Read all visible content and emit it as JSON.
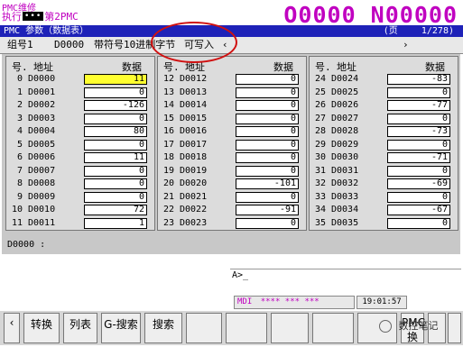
{
  "header": {
    "caption": "PMC维修",
    "mode_label": "执行",
    "mode_dots": "•••",
    "path_label": "第2PMC",
    "program_readout": "O0000 N00000"
  },
  "titlebar": {
    "title": "PMC 参数（数据表）",
    "page_label": "(页",
    "page_value": "1/278)"
  },
  "infobar": {
    "group_label": "组号1",
    "group_addr": "D0000",
    "desc": "带符号10进制字节",
    "mode": "可写入",
    "left_arrow": "‹",
    "right_arrow": "›"
  },
  "table": {
    "col_no": "号.",
    "col_addr": "地址",
    "col_data": "数据",
    "panels": [
      {
        "rows": [
          {
            "no": "0",
            "addr": "D0000",
            "val": "11"
          },
          {
            "no": "1",
            "addr": "D0001",
            "val": "0"
          },
          {
            "no": "2",
            "addr": "D0002",
            "val": "-126"
          },
          {
            "no": "3",
            "addr": "D0003",
            "val": "0"
          },
          {
            "no": "4",
            "addr": "D0004",
            "val": "80"
          },
          {
            "no": "5",
            "addr": "D0005",
            "val": "0"
          },
          {
            "no": "6",
            "addr": "D0006",
            "val": "11"
          },
          {
            "no": "7",
            "addr": "D0007",
            "val": "0"
          },
          {
            "no": "8",
            "addr": "D0008",
            "val": "0"
          },
          {
            "no": "9",
            "addr": "D0009",
            "val": "0"
          },
          {
            "no": "10",
            "addr": "D0010",
            "val": "72"
          },
          {
            "no": "11",
            "addr": "D0011",
            "val": "1"
          }
        ]
      },
      {
        "rows": [
          {
            "no": "12",
            "addr": "D0012",
            "val": "0"
          },
          {
            "no": "13",
            "addr": "D0013",
            "val": "0"
          },
          {
            "no": "14",
            "addr": "D0014",
            "val": "0"
          },
          {
            "no": "15",
            "addr": "D0015",
            "val": "0"
          },
          {
            "no": "16",
            "addr": "D0016",
            "val": "0"
          },
          {
            "no": "17",
            "addr": "D0017",
            "val": "0"
          },
          {
            "no": "18",
            "addr": "D0018",
            "val": "0"
          },
          {
            "no": "19",
            "addr": "D0019",
            "val": "0"
          },
          {
            "no": "20",
            "addr": "D0020",
            "val": "-101"
          },
          {
            "no": "21",
            "addr": "D0021",
            "val": "0"
          },
          {
            "no": "22",
            "addr": "D0022",
            "val": "-91"
          },
          {
            "no": "23",
            "addr": "D0023",
            "val": "0"
          }
        ]
      },
      {
        "rows": [
          {
            "no": "24",
            "addr": "D0024",
            "val": "-83"
          },
          {
            "no": "25",
            "addr": "D0025",
            "val": "0"
          },
          {
            "no": "26",
            "addr": "D0026",
            "val": "-77"
          },
          {
            "no": "27",
            "addr": "D0027",
            "val": "0"
          },
          {
            "no": "28",
            "addr": "D0028",
            "val": "-73"
          },
          {
            "no": "29",
            "addr": "D0029",
            "val": "0"
          },
          {
            "no": "30",
            "addr": "D0030",
            "val": "-71"
          },
          {
            "no": "31",
            "addr": "D0031",
            "val": "0"
          },
          {
            "no": "32",
            "addr": "D0032",
            "val": "-69"
          },
          {
            "no": "33",
            "addr": "D0033",
            "val": "0"
          },
          {
            "no": "34",
            "addr": "D0034",
            "val": "-67"
          },
          {
            "no": "35",
            "addr": "D0035",
            "val": "0"
          }
        ]
      }
    ]
  },
  "status": {
    "cursor_address": "D0000 :"
  },
  "input_line": {
    "prompt": "A>_"
  },
  "mode_bar": {
    "mode": "MDI",
    "stars": "**** *** ***",
    "time": "19:01:57"
  },
  "softkeys": [
    {
      "label": "‹"
    },
    {
      "label": "转换"
    },
    {
      "label": "列表"
    },
    {
      "label": "G-搜索"
    },
    {
      "label": "搜索"
    },
    {
      "label": ""
    },
    {
      "label": ""
    },
    {
      "label": ""
    },
    {
      "label": ""
    },
    {
      "label": ""
    },
    {
      "label": "PMC\n换"
    },
    {
      "label": ""
    },
    {
      "label": ""
    }
  ],
  "watermark": "数控笔记",
  "colors": {
    "title_bar": "#1e22b8",
    "accent_magenta": "#c000c0",
    "selected_cell": "#ffff30",
    "annotation": "#d01010"
  }
}
